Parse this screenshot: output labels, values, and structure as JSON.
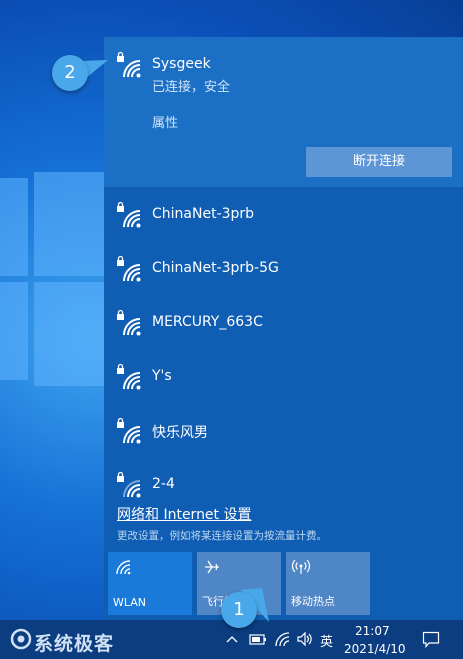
{
  "connected_network": {
    "name": "Sysgeek",
    "status": "已连接，安全",
    "properties_label": "属性",
    "disconnect_label": "断开连接"
  },
  "networks": [
    {
      "name": "ChinaNet-3prb",
      "icon": "wifi-secured-icon"
    },
    {
      "name": "ChinaNet-3prb-5G",
      "icon": "wifi-secured-icon"
    },
    {
      "name": "MERCURY_663C",
      "icon": "wifi-secured-icon"
    },
    {
      "name": "Y's",
      "icon": "wifi-secured-icon"
    },
    {
      "name": "快乐风男",
      "icon": "wifi-secured-icon"
    },
    {
      "name": "2-4",
      "icon": "wifi-secured-weak-icon"
    }
  ],
  "settings": {
    "link_label": "网络和 Internet 设置",
    "description": "更改设置，例如将某连接设置为按流量计费。"
  },
  "quick_actions": [
    {
      "label": "WLAN",
      "icon": "wifi-icon",
      "active": true
    },
    {
      "label": "飞行模式",
      "icon": "airplane-icon",
      "active": false
    },
    {
      "label": "移动热点",
      "icon": "hotspot-icon",
      "active": false
    }
  ],
  "taskbar": {
    "brand": "系统极客",
    "ime": "英",
    "time": "21:07",
    "date": "2021/4/10"
  },
  "callouts": {
    "first": "1",
    "second": "2"
  },
  "colors": {
    "flyout_bg": "#0f5eb3",
    "connected_bg": "#1b70c6",
    "tile_active": "#1a7ad9",
    "tile_inactive": "#4f86c6",
    "taskbar_bg": "#0b3d80",
    "badge": "#49a8ea"
  }
}
